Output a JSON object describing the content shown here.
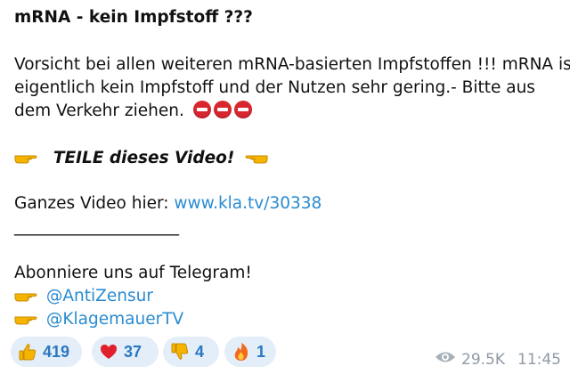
{
  "post": {
    "title": "mRNA - kein Impfstoff ???",
    "body_line1": "Vorsicht bei allen weiteren mRNA-basierten Impfstoffen !!! mRNA ist",
    "body_line2": "eigentlich kein Impfstoff und der Nutzen sehr gering.-  Bitte aus",
    "body_line3": "dem Verkehr ziehen.",
    "share_text": "TEILE dieses Video!",
    "video_label": "Ganzes Video hier: ",
    "video_link": "www.kla.tv/30338",
    "separator": "____________________",
    "subscribe_text": "Abonniere uns auf Telegram!",
    "channel1": "@AntiZensur",
    "channel2": "@KlagemauerTV"
  },
  "reactions": [
    {
      "emoji": "thumbs-up-icon",
      "count": "419"
    },
    {
      "emoji": "heart-icon",
      "count": "37"
    },
    {
      "emoji": "thumbs-down-icon",
      "count": "4"
    },
    {
      "emoji": "fire-icon",
      "count": "1"
    }
  ],
  "meta": {
    "views": "29.5K",
    "time": "11:45"
  },
  "colors": {
    "link": "#2a8bd0",
    "reaction_bg": "#e3eef9",
    "reaction_count": "#2a78c2",
    "meta": "#8f9aa5",
    "stop_red": "#d8262e"
  }
}
